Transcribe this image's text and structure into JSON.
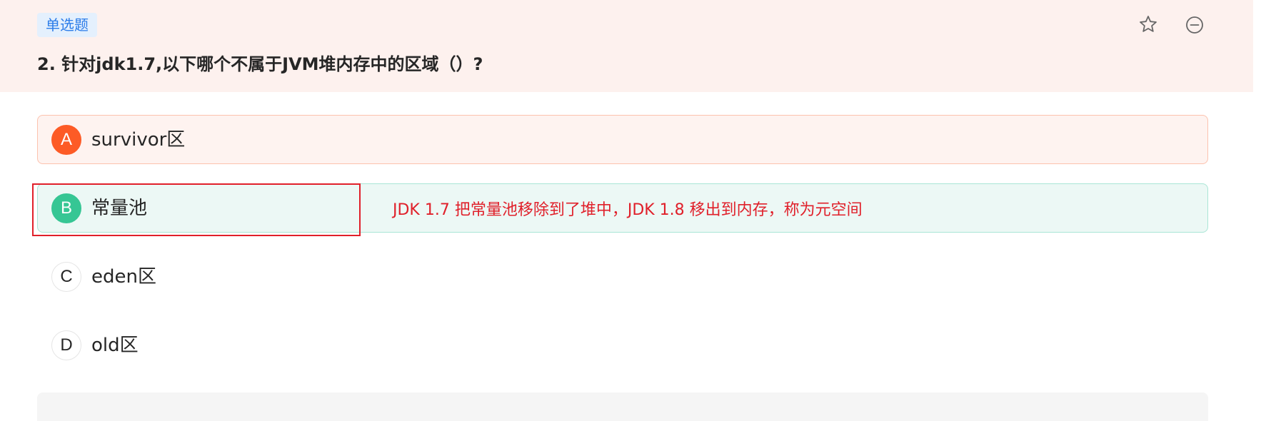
{
  "question": {
    "type_tag": "单选题",
    "title": "2. 针对jdk1.7,以下哪个不属于JVM堆内存中的区域（）?"
  },
  "header_icons": [
    "star-icon",
    "minus-circle-icon"
  ],
  "options": [
    {
      "letter": "A",
      "text": "survivor区",
      "state": "wrong"
    },
    {
      "letter": "B",
      "text": "常量池",
      "state": "correct"
    },
    {
      "letter": "C",
      "text": "eden区",
      "state": "normal"
    },
    {
      "letter": "D",
      "text": "old区",
      "state": "normal"
    }
  ],
  "annotation": "JDK 1.7 把常量池移除到了堆中，JDK 1.8 移出到内存，称为元空间",
  "colors": {
    "header_bg": "#fdf1ee",
    "tag_bg": "#e4f0fd",
    "tag_text": "#2b7ce9",
    "wrong_accent": "#fd5b26",
    "correct_accent": "#36c694",
    "annotation_red": "#e0202a"
  }
}
